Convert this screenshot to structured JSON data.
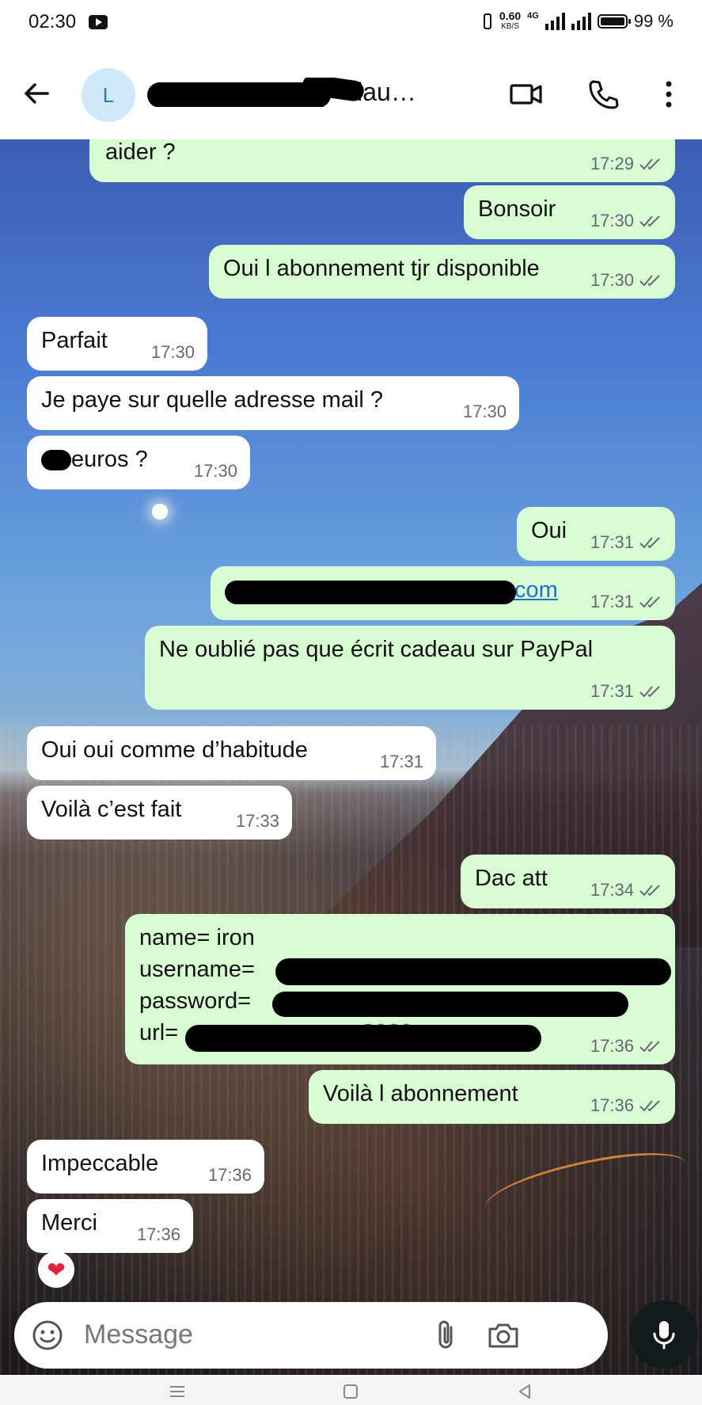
{
  "status": {
    "time": "02:30",
    "net_speed": "0.60",
    "net_unit": "KB/S",
    "net_tag": "4G",
    "battery": "99 %"
  },
  "header": {
    "avatar_letter": "L",
    "contact_name": "llau…"
  },
  "messages": [
    {
      "text": "aider ?",
      "time": "17:29",
      "dir": "out"
    },
    {
      "text": "Bonsoir",
      "time": "17:30",
      "dir": "out"
    },
    {
      "text": "Oui l abonnement tjr disponible",
      "time": "17:30",
      "dir": "out"
    },
    {
      "text": "Parfait",
      "time": "17:30",
      "dir": "in"
    },
    {
      "text": "Je paye sur quelle adresse mail ?",
      "time": "17:30",
      "dir": "in"
    },
    {
      "text": "euros ?",
      "time": "17:30",
      "dir": "in"
    },
    {
      "text": "Oui",
      "time": "17:31",
      "dir": "out"
    },
    {
      "text": ".com",
      "time": "17:31",
      "dir": "out"
    },
    {
      "text": "Ne oublié pas que écrit cadeau sur PayPal",
      "time": "17:31",
      "dir": "out"
    },
    {
      "text": "Oui oui comme d’habitude",
      "time": "17:31",
      "dir": "in"
    },
    {
      "text": "Voilà c’est fait",
      "time": "17:33",
      "dir": "in"
    },
    {
      "text": "Dac att",
      "time": "17:34",
      "dir": "out"
    },
    {
      "lines": [
        "name= iron",
        "username=",
        "password=",
        "url="
      ],
      "url_tail": "3080",
      "time": "17:36",
      "dir": "out"
    },
    {
      "text": "Voilà l abonnement",
      "time": "17:36",
      "dir": "out"
    },
    {
      "text": "Impeccable",
      "time": "17:36",
      "dir": "in"
    },
    {
      "text": "Merci",
      "time": "17:36",
      "dir": "in"
    }
  ],
  "reaction": "❤",
  "input": {
    "placeholder": "Message"
  },
  "icons": [
    "back-arrow-icon",
    "video-call-icon",
    "phone-icon",
    "more-vert-icon",
    "emoji-icon",
    "attach-icon",
    "camera-icon",
    "mic-icon"
  ]
}
